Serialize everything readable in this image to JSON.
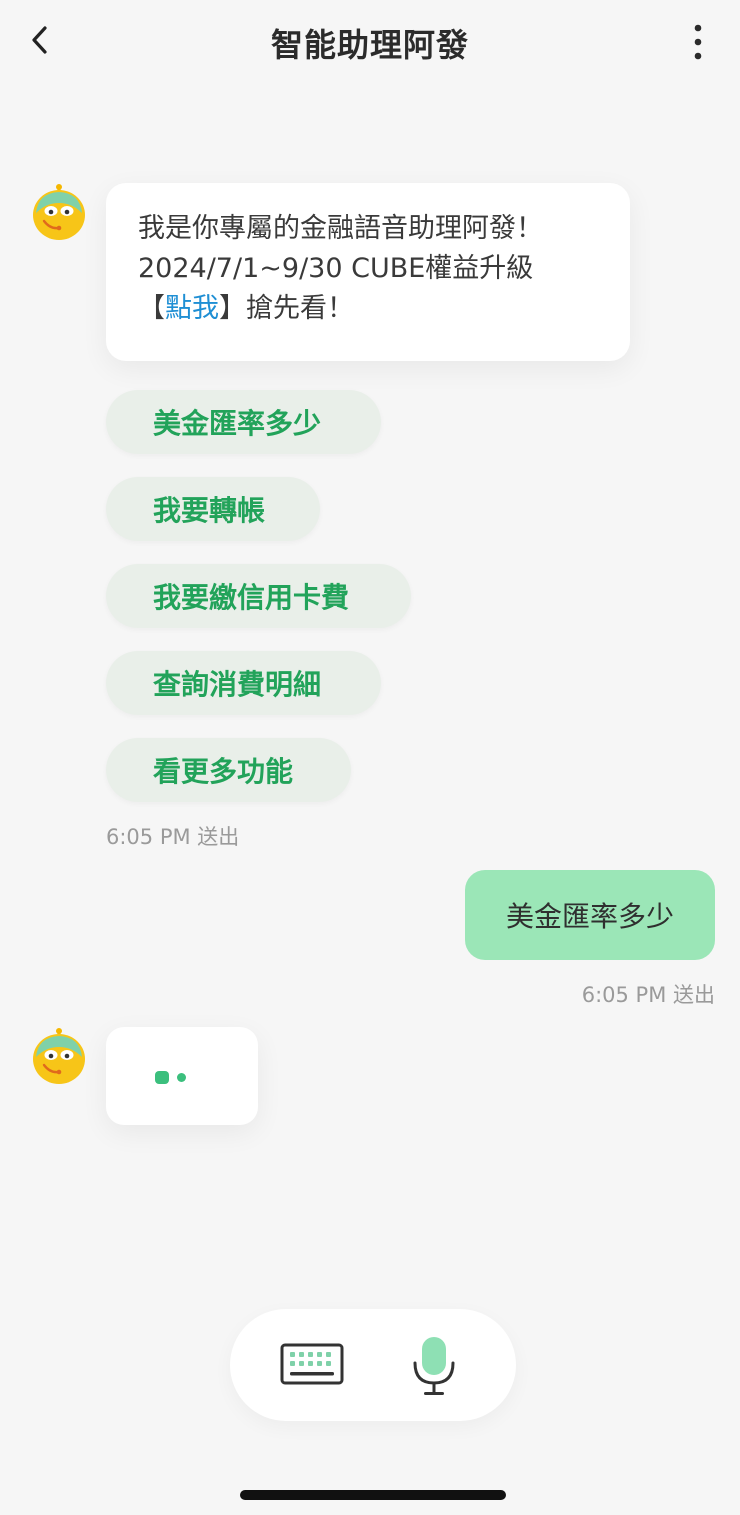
{
  "header": {
    "title": "智能助理阿發"
  },
  "bot_message": {
    "line1": "我是你專屬的金融語音助理阿發！",
    "line2": "2024/7/1~9/30 CUBE權益升級",
    "line3_prefix": "【",
    "line3_link": "點我",
    "line3_suffix": "】搶先看！"
  },
  "quick_replies": [
    {
      "label": "美金匯率多少"
    },
    {
      "label": "我要轉帳"
    },
    {
      "label": "我要繳信用卡費"
    },
    {
      "label": "查詢消費明細"
    },
    {
      "label": "看更多功能"
    }
  ],
  "bot_timestamp": "6:05 PM 送出",
  "user_message": {
    "text": "美金匯率多少",
    "timestamp": "6:05 PM 送出"
  },
  "icons": {
    "back": "chevron-left-icon",
    "more": "vertical-dots-icon",
    "avatar": "assistant-avatar-icon",
    "keyboard": "keyboard-icon",
    "mic": "microphone-icon"
  },
  "colors": {
    "accent_green": "#22a35a",
    "user_bubble": "#9be6b7",
    "link_blue": "#1f8fd4"
  }
}
